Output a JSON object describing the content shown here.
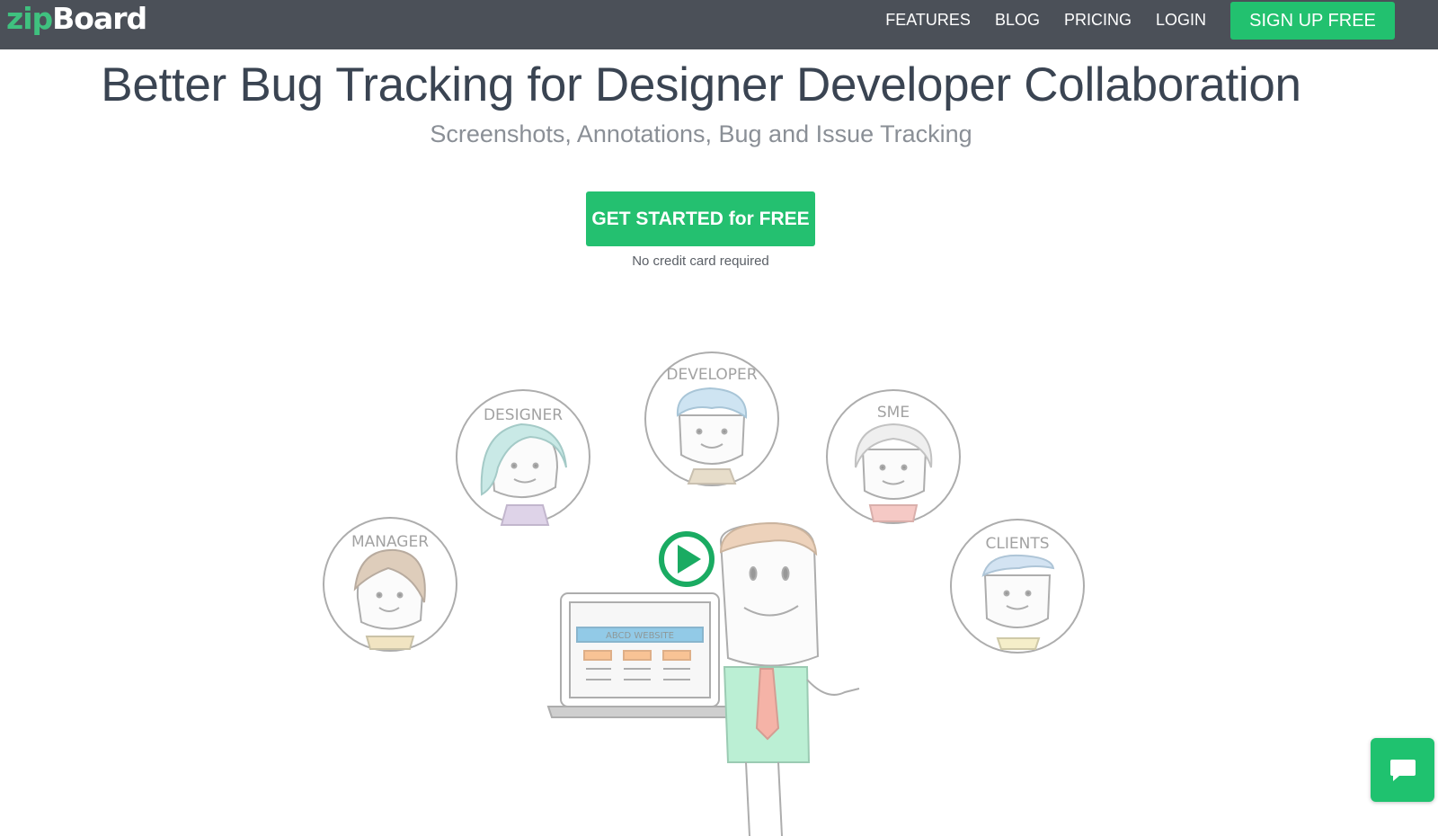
{
  "header": {
    "logo_zip": "zip",
    "logo_board": "Board",
    "nav": [
      {
        "label": "FEATURES"
      },
      {
        "label": "BLOG"
      },
      {
        "label": "PRICING"
      },
      {
        "label": "LOGIN"
      }
    ],
    "signup_label": "SIGN UP FREE"
  },
  "hero": {
    "title": "Better Bug Tracking for Designer Developer Collaboration",
    "subtitle": "Screenshots, Annotations, Bug and Issue Tracking",
    "cta_label": "GET STARTED for FREE",
    "cta_note": "No credit card required"
  },
  "illustration": {
    "roles": {
      "manager": "MANAGER",
      "designer": "DESIGNER",
      "developer": "DEVELOPER",
      "sme": "SME",
      "clients": "CLIENTS"
    },
    "laptop_banner": "ABCD WEBSITE"
  },
  "colors": {
    "topbar": "#4b5058",
    "brand_green": "#22c16f",
    "logo_green": "#3fc17f"
  },
  "icons": {
    "play": "play-icon",
    "chat": "chat-icon"
  }
}
